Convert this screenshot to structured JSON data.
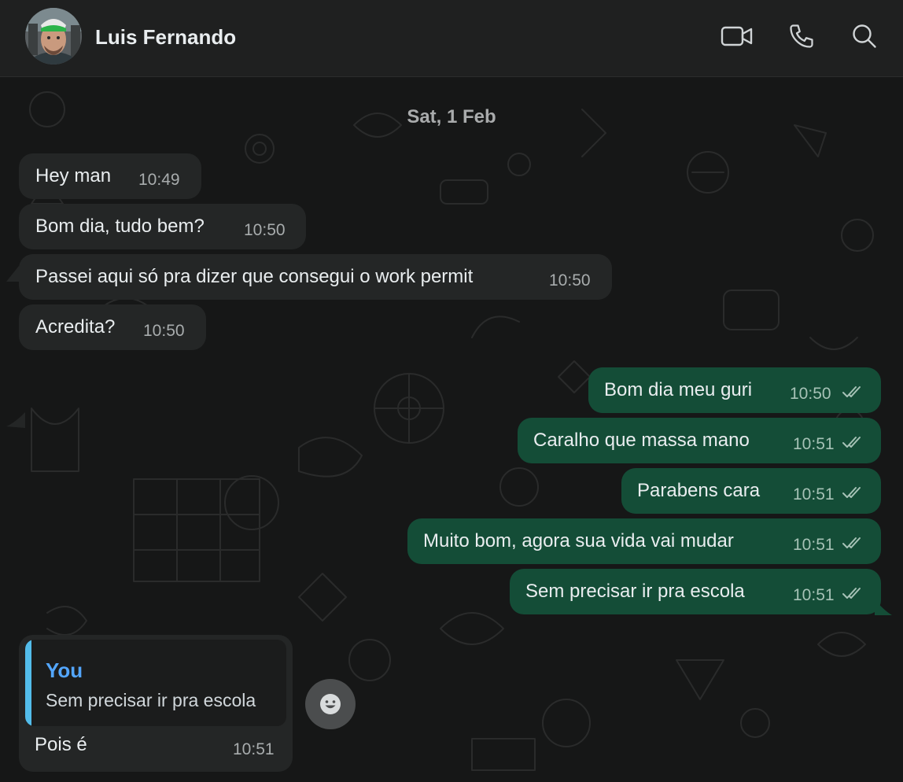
{
  "header": {
    "contact_name": "Luis Fernando",
    "icons": [
      "avatar",
      "video-call-icon",
      "voice-call-icon",
      "search-icon"
    ]
  },
  "chat": {
    "date": "Sat, 1 Feb",
    "messages": [
      {
        "direction": "incoming",
        "text": "Hey man",
        "time": "10:49"
      },
      {
        "direction": "incoming",
        "text": "Bom dia, tudo bem?",
        "time": "10:50"
      },
      {
        "direction": "incoming",
        "text": "Passei aqui só pra dizer que consegui o work permit",
        "time": "10:50"
      },
      {
        "direction": "incoming",
        "text": "Acredita?",
        "time": "10:50"
      },
      {
        "direction": "outgoing",
        "text": "Bom dia meu guri",
        "time": "10:50",
        "status": "read"
      },
      {
        "direction": "outgoing",
        "text": "Caralho que massa mano",
        "time": "10:51",
        "status": "read"
      },
      {
        "direction": "outgoing",
        "text": "Parabens cara",
        "time": "10:51",
        "status": "read"
      },
      {
        "direction": "outgoing",
        "text": "Muito bom, agora sua vida vai mudar",
        "time": "10:51",
        "status": "read"
      },
      {
        "direction": "outgoing",
        "text": "Sem precisar ir pra escola",
        "time": "10:51",
        "status": "read"
      }
    ],
    "reply": {
      "quoted_author": "You",
      "quoted_text": "Sem precisar ir pra escola",
      "text": "Pois é",
      "time": "10:51"
    }
  },
  "colors": {
    "incoming_bubble": "#242626",
    "outgoing_bubble": "#144d37",
    "quote_author": "#53a6fd",
    "background": "#161717"
  }
}
